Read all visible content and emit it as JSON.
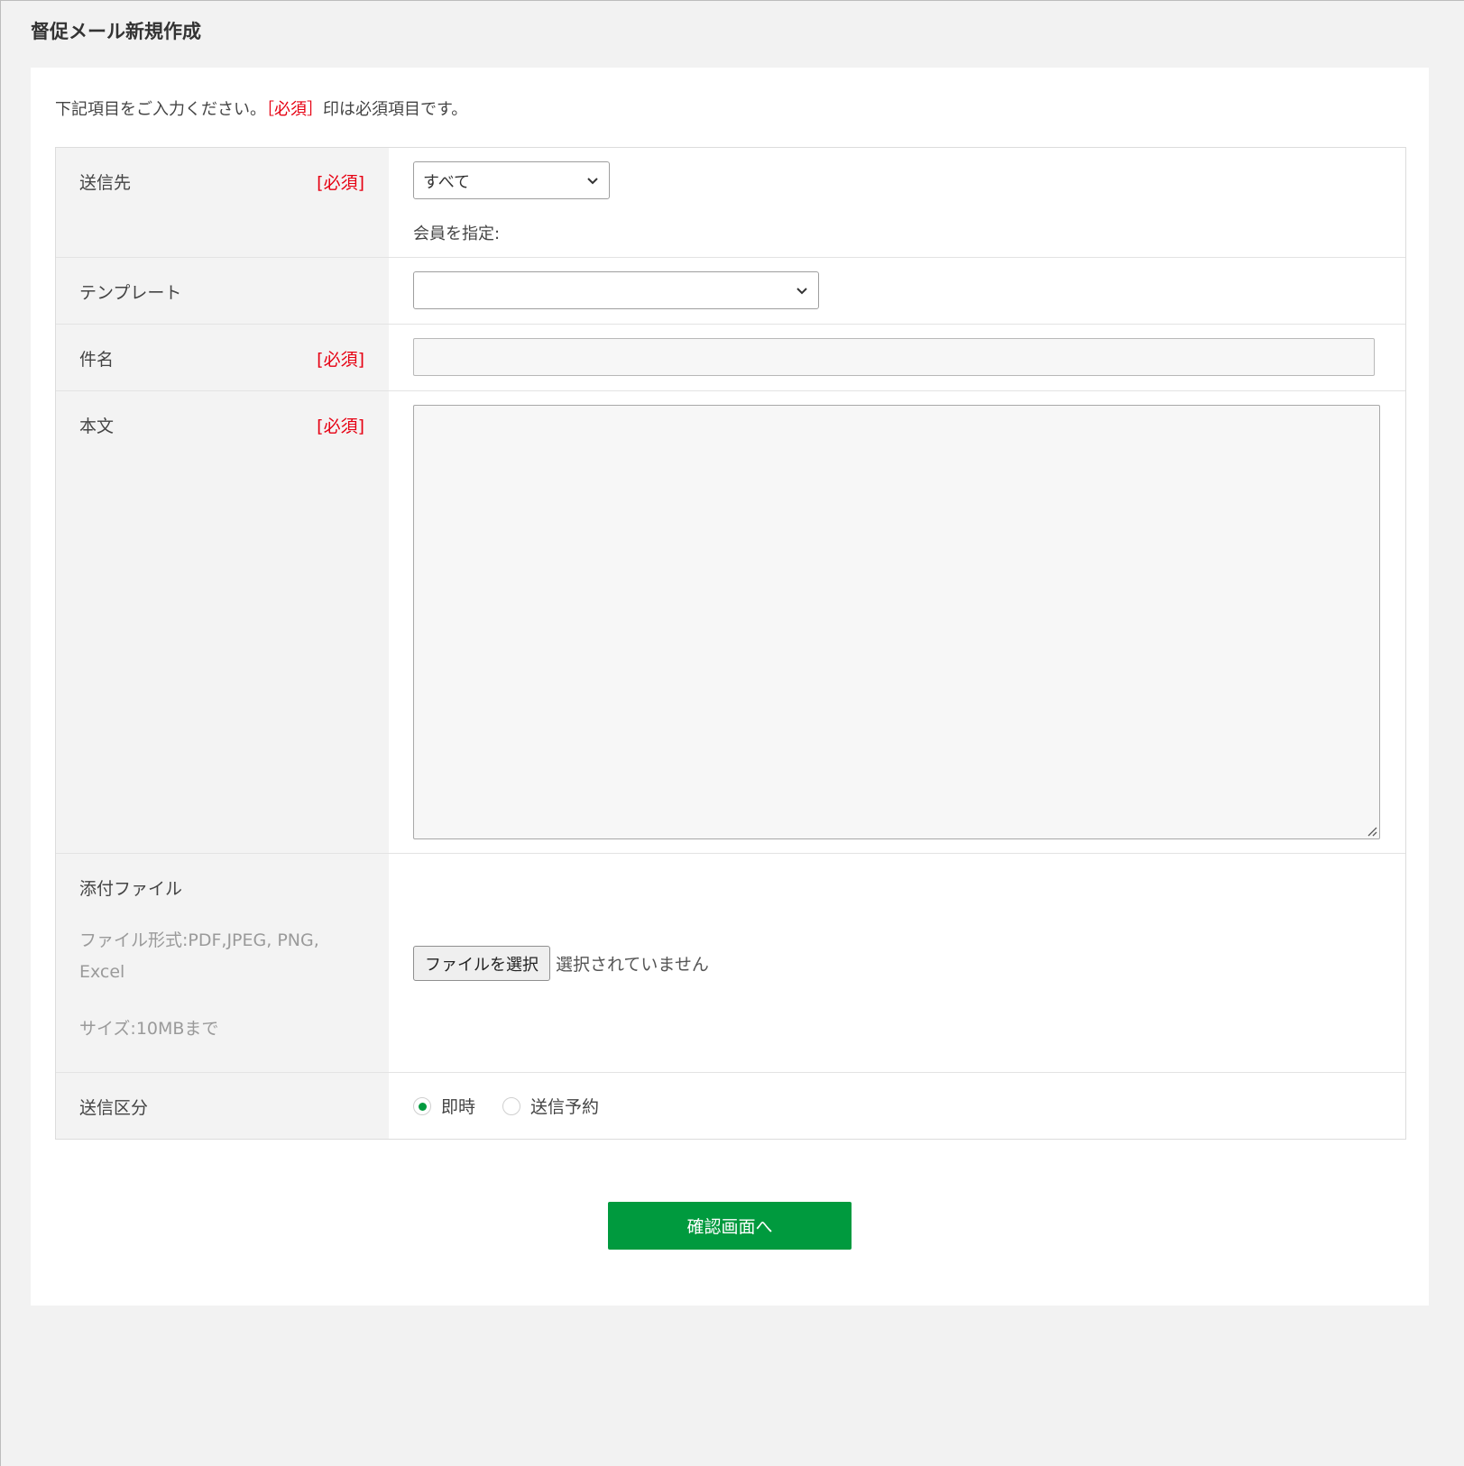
{
  "page": {
    "title": "督促メール新規作成"
  },
  "intro": {
    "before": "下記項目をご入力ください。",
    "required_mark": "［必須］",
    "after": "印は必須項目です。"
  },
  "form": {
    "required_label": "[必須]",
    "recipient": {
      "label": "送信先",
      "select_value": "すべて",
      "member_label": "会員を指定:"
    },
    "template": {
      "label": "テンプレート",
      "select_value": ""
    },
    "subject": {
      "label": "件名",
      "value": ""
    },
    "body": {
      "label": "本文",
      "value": ""
    },
    "attachment": {
      "label": "添付ファイル",
      "format_note": "ファイル形式:PDF,JPEG, PNG, Excel",
      "size_note": "サイズ:10MBまで",
      "button_label": "ファイルを選択",
      "status": "選択されていません"
    },
    "send_type": {
      "label": "送信区分",
      "options": [
        {
          "label": "即時",
          "checked": true
        },
        {
          "label": "送信予約",
          "checked": false
        }
      ]
    }
  },
  "actions": {
    "submit_label": "確認画面へ"
  },
  "colors": {
    "accent": "#009a3e",
    "required": "#e60012",
    "background": "#f2f2f2",
    "header_cell": "#f3f3f3"
  }
}
